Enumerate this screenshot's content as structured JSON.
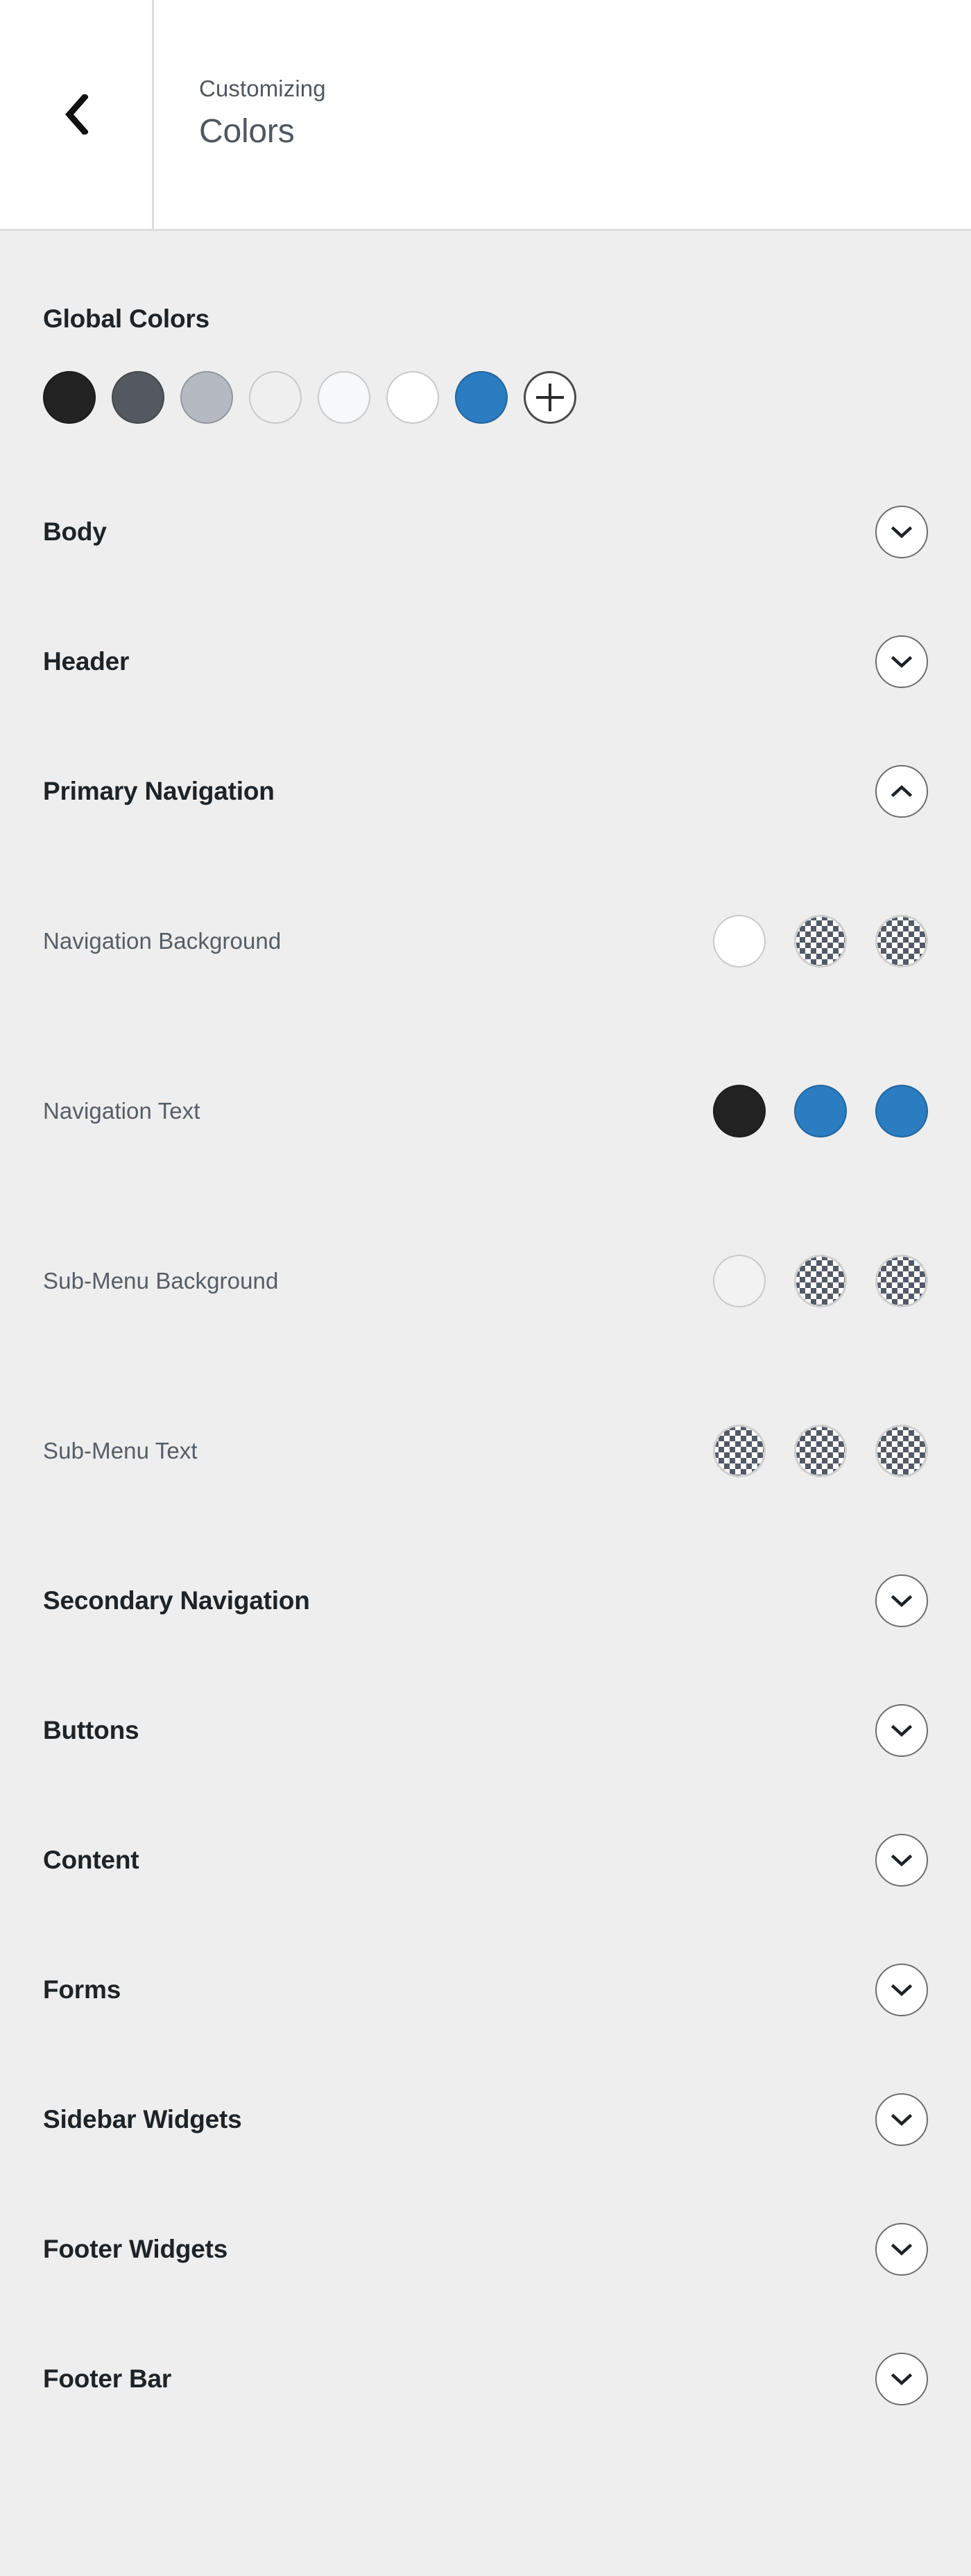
{
  "header": {
    "back_icon": "chevron-left-icon",
    "eyebrow": "Customizing",
    "title": "Colors"
  },
  "global_colors": {
    "title": "Global Colors",
    "add_icon": "plus-icon",
    "add_label": "+",
    "swatches": [
      {
        "name": "global-color-1",
        "color": "#222222",
        "kind": "solid"
      },
      {
        "name": "global-color-2",
        "color": "#54595f",
        "kind": "solid"
      },
      {
        "name": "global-color-3",
        "color": "#b4b9c2",
        "kind": "solid"
      },
      {
        "name": "global-color-4",
        "color": "#efefef",
        "kind": "solid"
      },
      {
        "name": "global-color-5",
        "color": "#f7f8f9",
        "kind": "solid"
      },
      {
        "name": "global-color-6",
        "color": "#ffffff",
        "kind": "solid"
      },
      {
        "name": "global-color-7",
        "color": "#2b7cc0",
        "kind": "solid"
      }
    ]
  },
  "sections": [
    {
      "name": "body",
      "label": "Body",
      "expanded": false,
      "toggle_icon": "chevron-down-icon",
      "controls": []
    },
    {
      "name": "header",
      "label": "Header",
      "expanded": false,
      "toggle_icon": "chevron-down-icon",
      "controls": []
    },
    {
      "name": "primary-navigation",
      "label": "Primary Navigation",
      "expanded": true,
      "toggle_icon": "chevron-up-icon",
      "controls": [
        {
          "name": "navigation-background",
          "label": "Navigation Background",
          "swatches": [
            {
              "kind": "solid",
              "color": "#ffffff"
            },
            {
              "kind": "transparent",
              "color": "transparent"
            },
            {
              "kind": "transparent",
              "color": "transparent"
            }
          ]
        },
        {
          "name": "navigation-text",
          "label": "Navigation Text",
          "swatches": [
            {
              "kind": "solid",
              "color": "#222222"
            },
            {
              "kind": "solid",
              "color": "#2b7cc0"
            },
            {
              "kind": "solid",
              "color": "#2b7cc0"
            }
          ]
        },
        {
          "name": "sub-menu-background",
          "label": "Sub-Menu Background",
          "swatches": [
            {
              "kind": "solid",
              "color": "#f2f2f2"
            },
            {
              "kind": "transparent",
              "color": "transparent"
            },
            {
              "kind": "transparent",
              "color": "transparent"
            }
          ]
        },
        {
          "name": "sub-menu-text",
          "label": "Sub-Menu Text",
          "swatches": [
            {
              "kind": "transparent",
              "color": "transparent"
            },
            {
              "kind": "transparent",
              "color": "transparent"
            },
            {
              "kind": "transparent",
              "color": "transparent"
            }
          ]
        }
      ]
    },
    {
      "name": "secondary-navigation",
      "label": "Secondary Navigation",
      "expanded": false,
      "toggle_icon": "chevron-down-icon",
      "controls": []
    },
    {
      "name": "buttons",
      "label": "Buttons",
      "expanded": false,
      "toggle_icon": "chevron-down-icon",
      "controls": []
    },
    {
      "name": "content",
      "label": "Content",
      "expanded": false,
      "toggle_icon": "chevron-down-icon",
      "controls": []
    },
    {
      "name": "forms",
      "label": "Forms",
      "expanded": false,
      "toggle_icon": "chevron-down-icon",
      "controls": []
    },
    {
      "name": "sidebar-widgets",
      "label": "Sidebar Widgets",
      "expanded": false,
      "toggle_icon": "chevron-down-icon",
      "controls": []
    },
    {
      "name": "footer-widgets",
      "label": "Footer Widgets",
      "expanded": false,
      "toggle_icon": "chevron-down-icon",
      "controls": []
    },
    {
      "name": "footer-bar",
      "label": "Footer Bar",
      "expanded": false,
      "toggle_icon": "chevron-down-icon",
      "controls": []
    }
  ],
  "theme": {
    "panel_bg": "#eeeeee",
    "header_bg": "#ffffff",
    "heading_text": "#1d2327",
    "sub_label_text": "#555d66",
    "accent_blue": "#2b7cc0",
    "border": "#dddddd"
  }
}
